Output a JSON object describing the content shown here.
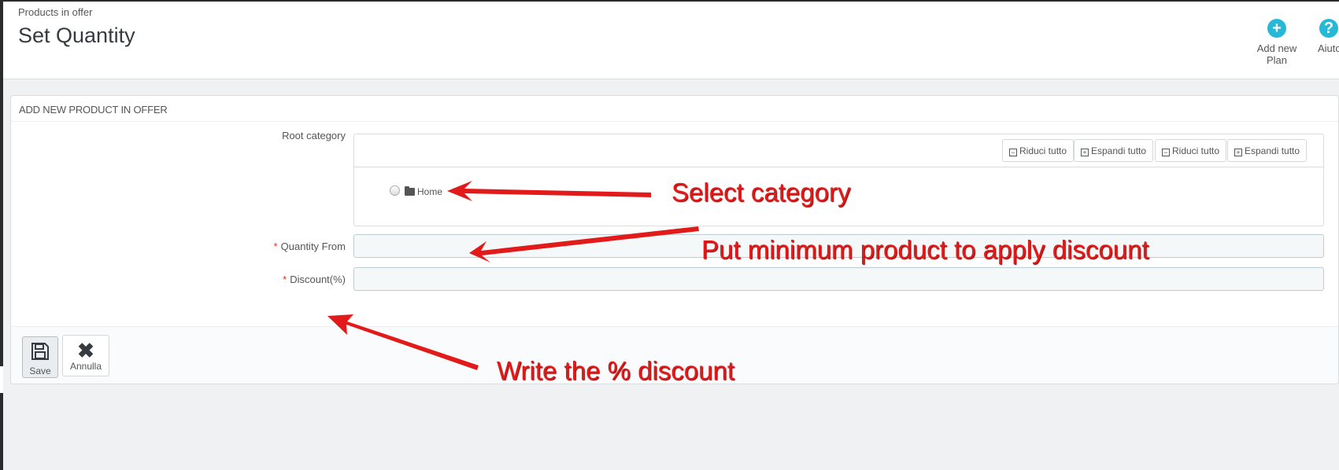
{
  "header": {
    "breadcrumb": "Products in offer",
    "title": "Set Quantity",
    "add_plan_label": "Add new Plan",
    "help_label": "Aiuto"
  },
  "panel": {
    "heading": "ADD NEW PRODUCT IN OFFER",
    "root_category_label": "Root category",
    "tree_buttons": [
      "Riduci tutto",
      "Espandi tutto",
      "Riduci tutto",
      "Espandi tutto"
    ],
    "tree_root": "Home",
    "quantity_from_label": "Quantity From",
    "quantity_from_value": "",
    "discount_label": "Discount(%)",
    "discount_value": "",
    "required_mark": "*"
  },
  "footer": {
    "save_label": "Save",
    "cancel_label": "Annulla"
  },
  "annotations": {
    "select_category": "Select category",
    "minimum_product": "Put minimum product to apply discount",
    "write_discount": "Write the % discount"
  },
  "colors": {
    "accent": "#25b9d7",
    "annotation": "#e21a1a",
    "required": "#e0302b"
  }
}
